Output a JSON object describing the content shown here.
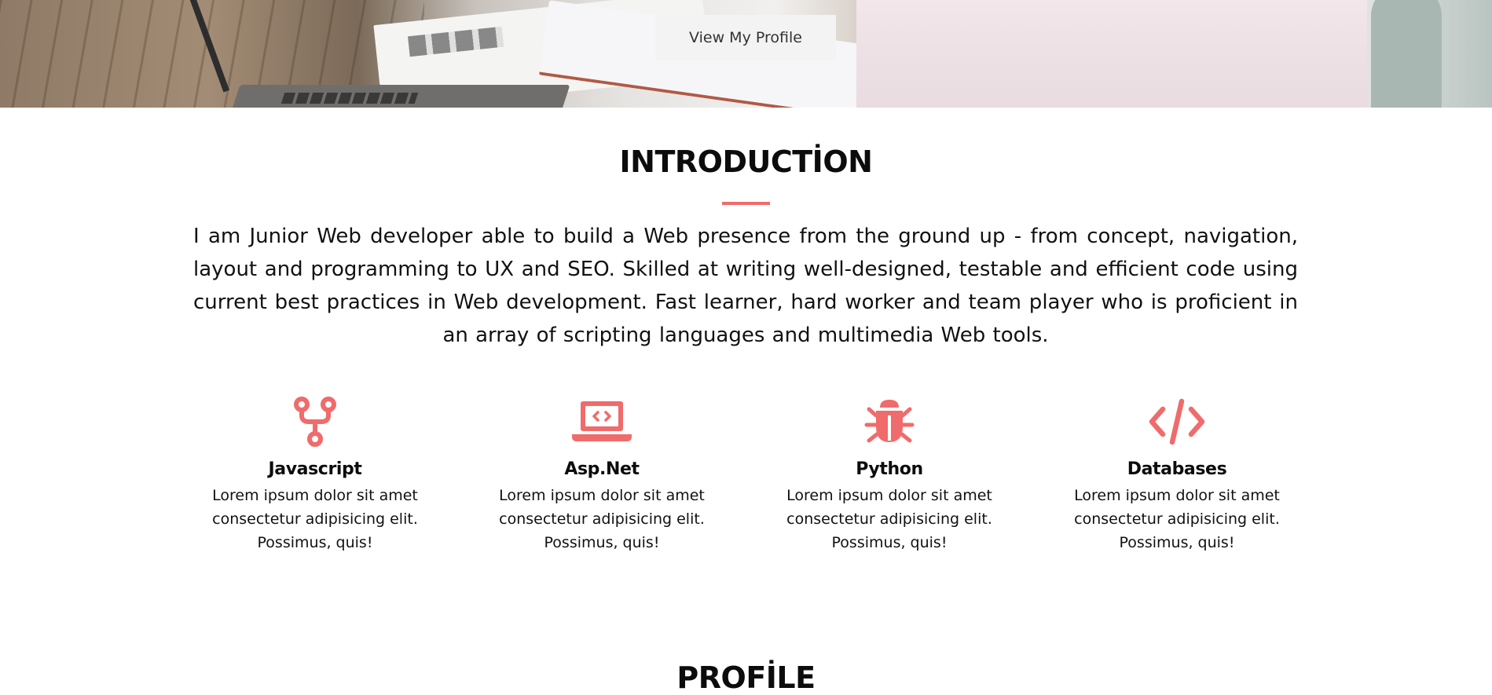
{
  "hero": {
    "button_label": "View My Profile"
  },
  "intro": {
    "title": "INTRODUCTİON",
    "text": "I am Junior Web developer able to build a Web presence from the ground up - from concept, navigation, layout and programming to UX and SEO. Skilled at writing well-designed, testable and efficient code using current best practices in Web development. Fast learner, hard worker and team player who is proficient in an array of scripting languages and multimedia Web tools."
  },
  "skills": [
    {
      "icon": "code-fork-icon",
      "name": "Javascript",
      "desc": "Lorem ipsum dolor sit amet consectetur adipisicing elit. Possimus, quis!"
    },
    {
      "icon": "laptop-code-icon",
      "name": "Asp.Net",
      "desc": "Lorem ipsum dolor sit amet consectetur adipisicing elit. Possimus, quis!"
    },
    {
      "icon": "bug-icon",
      "name": "Python",
      "desc": "Lorem ipsum dolor sit amet consectetur adipisicing elit. Possimus, quis!"
    },
    {
      "icon": "code-icon",
      "name": "Databases",
      "desc": "Lorem ipsum dolor sit amet consectetur adipisicing elit. Possimus, quis!"
    }
  ],
  "profile": {
    "title": "PROFİLE"
  },
  "colors": {
    "accent": "#f06b6b",
    "button_bg": "#f3f3f3",
    "text": "#111111"
  }
}
